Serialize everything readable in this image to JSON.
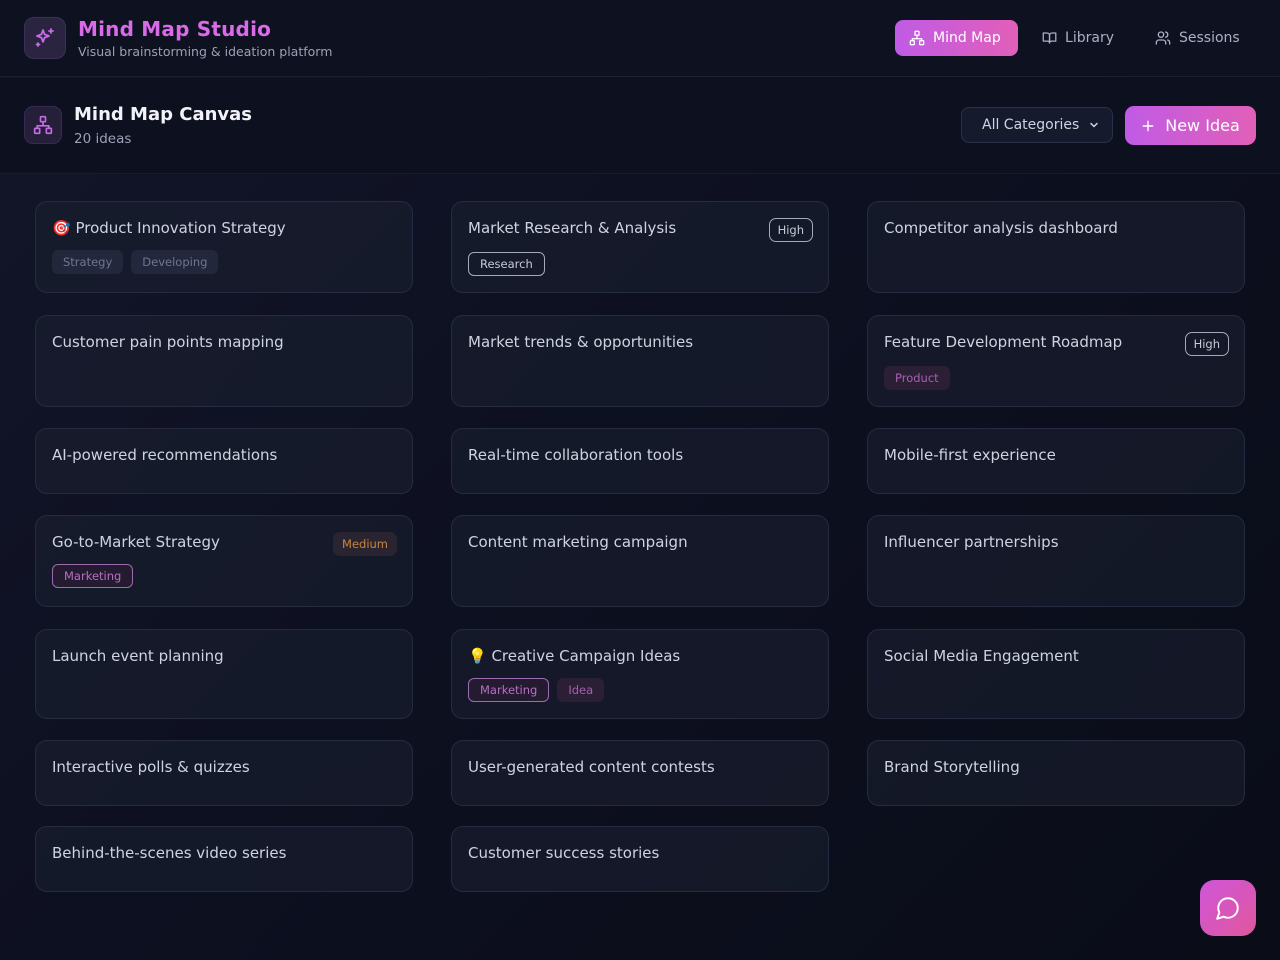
{
  "header": {
    "title": "Mind Map Studio",
    "subtitle": "Visual brainstorming & ideation platform",
    "logo_icon": "sparkles-icon",
    "nav": [
      {
        "label": "Mind Map",
        "icon": "network-icon",
        "active": true
      },
      {
        "label": "Library",
        "icon": "book-icon",
        "active": false
      },
      {
        "label": "Sessions",
        "icon": "users-icon",
        "active": false
      }
    ]
  },
  "canvas": {
    "title": "Mind Map Canvas",
    "count": "20 ideas",
    "category_filter": "All Categories",
    "new_idea_label": "New Idea"
  },
  "cards": [
    {
      "title": "🎯 Product Innovation Strategy",
      "tags": [
        {
          "text": "Strategy",
          "style": "muted"
        },
        {
          "text": "Developing",
          "style": "muted"
        }
      ],
      "priority": ""
    },
    {
      "title": "Market Research & Analysis",
      "tags": [
        {
          "text": "Research",
          "style": "outline-white"
        }
      ],
      "priority": "High"
    },
    {
      "title": "Competitor analysis dashboard",
      "tags": [],
      "priority": ""
    },
    {
      "title": "Customer pain points mapping",
      "tags": [],
      "priority": ""
    },
    {
      "title": "Market trends & opportunities",
      "tags": [],
      "priority": ""
    },
    {
      "title": "Feature Development Roadmap",
      "tags": [
        {
          "text": "Product",
          "style": "product"
        }
      ],
      "priority": "High"
    },
    {
      "title": "AI-powered recommendations",
      "tags": [],
      "priority": ""
    },
    {
      "title": "Real-time collaboration tools",
      "tags": [],
      "priority": ""
    },
    {
      "title": "Mobile-first experience",
      "tags": [],
      "priority": ""
    },
    {
      "title": "Go-to-Market Strategy",
      "tags": [
        {
          "text": "Marketing",
          "style": "outline-pink"
        }
      ],
      "priority": "Medium"
    },
    {
      "title": "Content marketing campaign",
      "tags": [],
      "priority": ""
    },
    {
      "title": "Influencer partnerships",
      "tags": [],
      "priority": ""
    },
    {
      "title": "Launch event planning",
      "tags": [],
      "priority": ""
    },
    {
      "title": "💡 Creative Campaign Ideas",
      "tags": [
        {
          "text": "Marketing",
          "style": "outline-pink"
        },
        {
          "text": "Idea",
          "style": "idea"
        }
      ],
      "priority": ""
    },
    {
      "title": "Social Media Engagement",
      "tags": [],
      "priority": ""
    },
    {
      "title": "Interactive polls & quizzes",
      "tags": [],
      "priority": ""
    },
    {
      "title": "User-generated content contests",
      "tags": [],
      "priority": ""
    },
    {
      "title": "Brand Storytelling",
      "tags": [],
      "priority": ""
    },
    {
      "title": "Behind-the-scenes video series",
      "tags": [],
      "priority": ""
    },
    {
      "title": "Customer success stories",
      "tags": [],
      "priority": ""
    }
  ],
  "chat_icon": "chat-bubble-icon"
}
